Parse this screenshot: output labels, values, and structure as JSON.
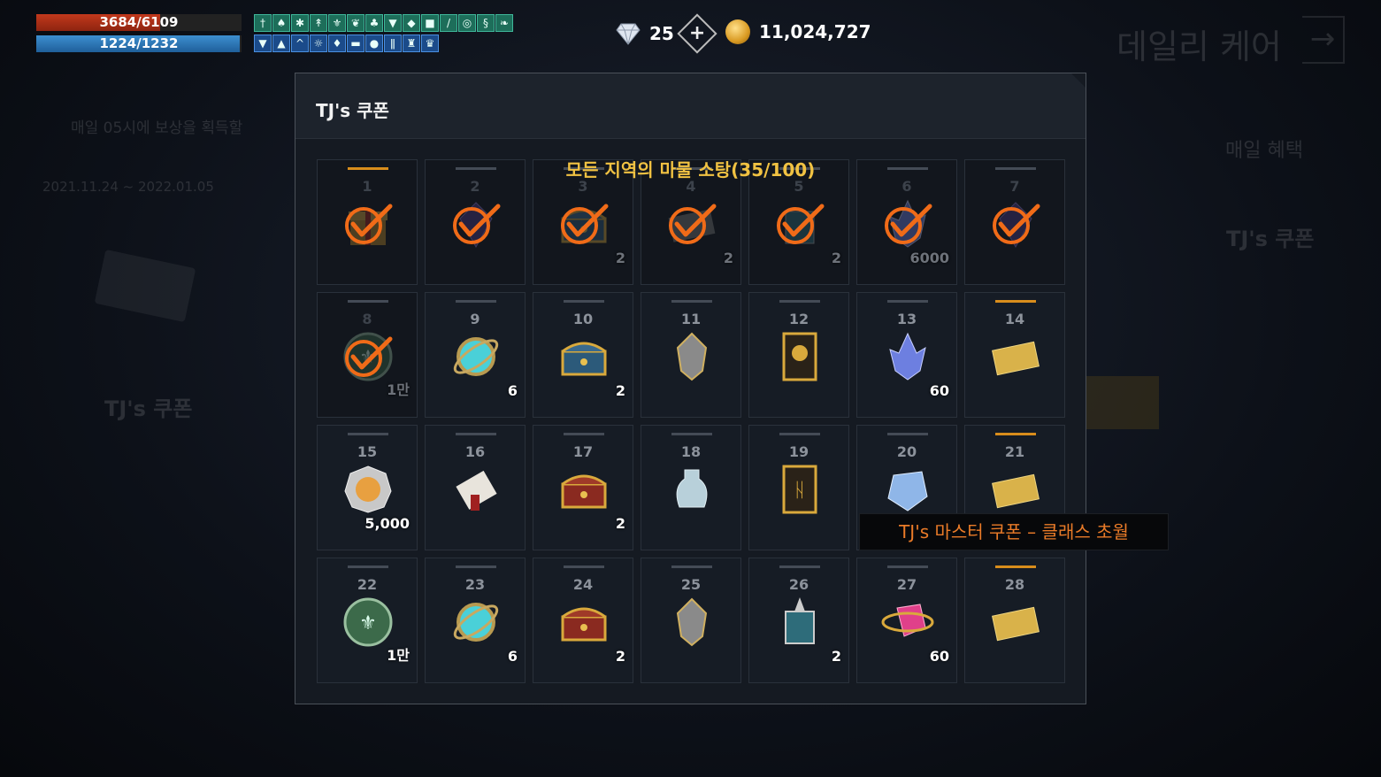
{
  "hud": {
    "hp": {
      "text": "3684/6109",
      "fraction": 0.603
    },
    "mp": {
      "text": "1224/1232",
      "fraction": 0.993
    },
    "buffs_row1": [
      "sword-buff",
      "potion-buff",
      "bug-buff",
      "arrow-buff",
      "fleur-buff",
      "leaf-buff",
      "tree-buff",
      "shirt-buff",
      "wolf-buff",
      "armor-buff",
      "wand-buff",
      "shield-buff",
      "dragon-buff",
      "feather-buff"
    ],
    "buffs_row2": [
      "shirt-buff",
      "rocket-buff",
      "mountain-buff",
      "sun-buff",
      "flame-buff",
      "chest-buff",
      "helm-buff",
      "rune-buff",
      "lamp-buff",
      "trophy-buff"
    ]
  },
  "currency": {
    "gems": "25",
    "gold": "11,024,727",
    "gem_color": "#cfd8e6",
    "gold_color": "#d99a22"
  },
  "background": {
    "title": "데일리 케어",
    "exit_icon": "→",
    "notice": "매일 05시에 보상을 획득할",
    "period": "2021.11.24 ~ 2022.01.05",
    "left_coupon": "TJ's 쿠폰",
    "daily_benefit": "매일 혜택",
    "right_coupon": "TJ's 쿠폰"
  },
  "dialog": {
    "title": "TJ's 쿠폰",
    "quest": "모든 지역의 마물 소탕(35/100)",
    "accent_color": "#d88d1c",
    "check_color": "#f06b18",
    "days": [
      {
        "day": "1",
        "item": "gift-box",
        "qty": "",
        "claimed": true,
        "special": true
      },
      {
        "day": "2",
        "item": "dark-gem",
        "qty": "",
        "claimed": true,
        "special": false
      },
      {
        "day": "3",
        "item": "chest",
        "qty": "2",
        "claimed": true,
        "special": false
      },
      {
        "day": "4",
        "item": "ticket",
        "qty": "2",
        "claimed": true,
        "special": false
      },
      {
        "day": "5",
        "item": "potion-box",
        "qty": "2",
        "claimed": true,
        "special": false
      },
      {
        "day": "6",
        "item": "crystal",
        "qty": "6000",
        "claimed": true,
        "special": false
      },
      {
        "day": "7",
        "item": "dark-gem",
        "qty": "",
        "claimed": true,
        "special": false
      },
      {
        "day": "8",
        "item": "green-coin",
        "qty": "1만",
        "claimed": true,
        "special": false
      },
      {
        "day": "9",
        "item": "orb",
        "qty": "6",
        "claimed": false,
        "special": false
      },
      {
        "day": "10",
        "item": "chest",
        "qty": "2",
        "claimed": false,
        "special": false
      },
      {
        "day": "11",
        "item": "stone",
        "qty": "",
        "claimed": false,
        "special": false
      },
      {
        "day": "12",
        "item": "card-hood",
        "qty": "",
        "claimed": false,
        "special": false
      },
      {
        "day": "13",
        "item": "crystal",
        "qty": "60",
        "claimed": false,
        "special": false
      },
      {
        "day": "14",
        "item": "gold-ticket",
        "qty": "",
        "claimed": false,
        "special": true
      },
      {
        "day": "15",
        "item": "silver-coin",
        "qty": "5,000",
        "claimed": false,
        "special": false
      },
      {
        "day": "16",
        "item": "scroll",
        "qty": "",
        "claimed": false,
        "special": false
      },
      {
        "day": "17",
        "item": "red-chest",
        "qty": "2",
        "claimed": false,
        "special": false
      },
      {
        "day": "18",
        "item": "vial",
        "qty": "",
        "claimed": false,
        "special": false
      },
      {
        "day": "19",
        "item": "card-rune",
        "qty": "",
        "claimed": false,
        "special": false
      },
      {
        "day": "20",
        "item": "ice-crystal",
        "qty": "",
        "claimed": false,
        "special": false
      },
      {
        "day": "21",
        "item": "gold-ticket",
        "qty": "",
        "claimed": false,
        "special": true
      },
      {
        "day": "22",
        "item": "green-coin",
        "qty": "1만",
        "claimed": false,
        "special": false
      },
      {
        "day": "23",
        "item": "orb",
        "qty": "6",
        "claimed": false,
        "special": false
      },
      {
        "day": "24",
        "item": "red-chest",
        "qty": "2",
        "claimed": false,
        "special": false
      },
      {
        "day": "25",
        "item": "stone",
        "qty": "",
        "claimed": false,
        "special": false
      },
      {
        "day": "26",
        "item": "lantern",
        "qty": "2",
        "claimed": false,
        "special": false
      },
      {
        "day": "27",
        "item": "pink-gem",
        "qty": "60",
        "claimed": false,
        "special": false
      },
      {
        "day": "28",
        "item": "gold-ticket",
        "qty": "",
        "claimed": false,
        "special": true
      }
    ]
  },
  "tooltip": {
    "text": "TJ's 마스터 쿠폰 – 클래스 초월"
  }
}
